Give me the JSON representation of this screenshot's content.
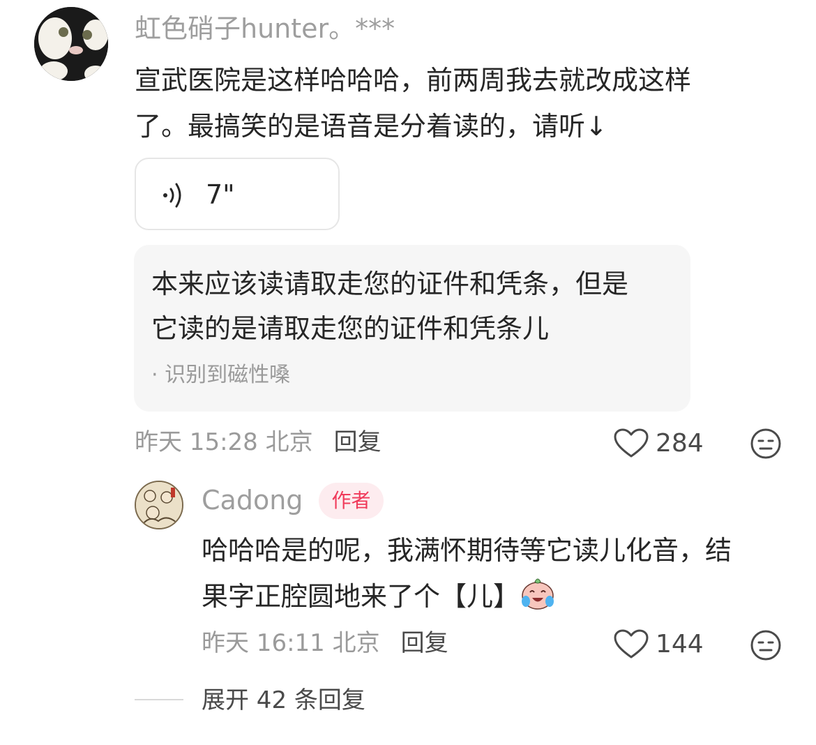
{
  "comment": {
    "username": "虹色硝子hunter。***",
    "text_line1": "宣武医院是这样哈哈哈，前两周我去就改成这样",
    "text_line2": "了。最搞笑的是语音是分着读的，请听↓",
    "voice": {
      "duration": "7\""
    },
    "transcript": {
      "line1": "本来应该读请取走您的证件和凭条，但是",
      "line2": "它读的是请取走您的证件和凭条儿",
      "note": "· 识别到磁性嗓"
    },
    "meta": {
      "time": "昨天 15:28 北京",
      "reply_label": "回复",
      "likes": "284"
    }
  },
  "reply": {
    "username": "Cadong",
    "badge": "作者",
    "text_line1": "哈哈哈是的呢，我满怀期待等它读儿化音，结",
    "text_line2": "果字正腔圆地来了个【儿】",
    "meta": {
      "time": "昨天 16:11 北京",
      "reply_label": "回复",
      "likes": "144"
    }
  },
  "expand": {
    "label": "展开 42 条回复"
  },
  "icons": {
    "like": "heart-outline-icon",
    "dislike": "neutral-face-icon",
    "voice": "sound-wave-icon",
    "emoji": "crying-laughing-face-icon"
  },
  "colors": {
    "author_badge_text": "#f03a5a",
    "author_badge_bg": "#fdecef"
  }
}
